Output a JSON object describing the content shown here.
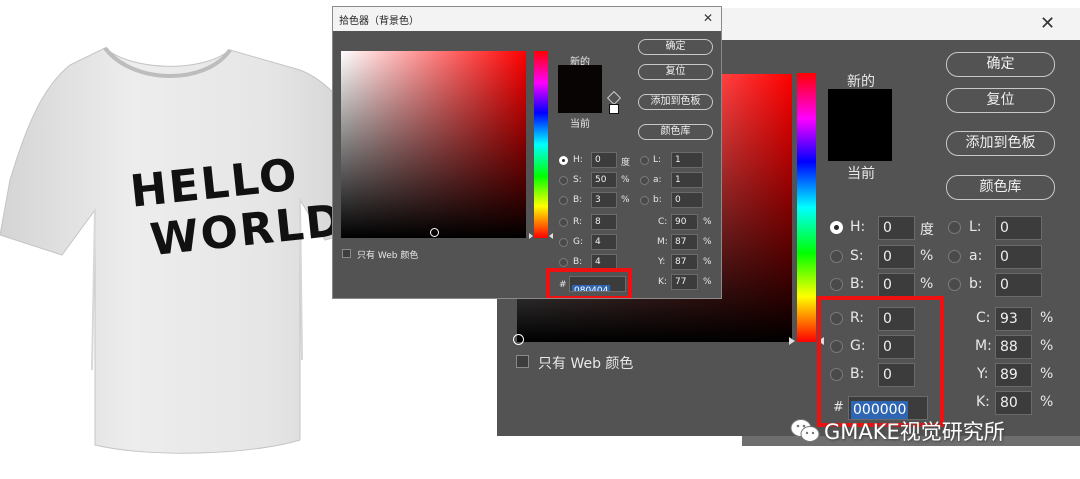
{
  "tshirt": {
    "print_line1": "HELLO",
    "print_line2": "WORLD"
  },
  "big_picker": {
    "close_glyph": "✕",
    "buttons": {
      "ok": "确定",
      "reset": "复位",
      "add_to_swatches": "添加到色板",
      "color_libraries": "颜色库"
    },
    "new_label": "新的",
    "current_label": "当前",
    "new_color": "#000000",
    "current_color": "#000000",
    "hsb": [
      {
        "label": "H:",
        "value": "0",
        "unit": "度"
      },
      {
        "label": "S:",
        "value": "0",
        "unit": "%"
      },
      {
        "label": "B:",
        "value": "0",
        "unit": "%"
      }
    ],
    "lab": [
      {
        "label": "L:",
        "value": "0"
      },
      {
        "label": "a:",
        "value": "0"
      },
      {
        "label": "b:",
        "value": "0"
      }
    ],
    "rgb": [
      {
        "label": "R:",
        "value": "0"
      },
      {
        "label": "G:",
        "value": "0"
      },
      {
        "label": "B:",
        "value": "0"
      }
    ],
    "cmyk": [
      {
        "label": "C:",
        "value": "93",
        "unit": "%"
      },
      {
        "label": "M:",
        "value": "88",
        "unit": "%"
      },
      {
        "label": "Y:",
        "value": "89",
        "unit": "%"
      },
      {
        "label": "K:",
        "value": "80",
        "unit": "%"
      }
    ],
    "hex_label": "#",
    "hex_value": "000000",
    "web_only_label": "只有 Web 颜色"
  },
  "small_picker": {
    "title": "拾色器（背景色）",
    "close_glyph": "✕",
    "buttons": {
      "ok": "确定",
      "reset": "复位",
      "add_to_swatches": "添加到色板",
      "color_libraries": "颜色库"
    },
    "new_label": "新的",
    "current_label": "当前",
    "new_color": "#080404",
    "current_color": "#080404",
    "hsb": [
      {
        "label": "H:",
        "value": "0",
        "unit": "度"
      },
      {
        "label": "S:",
        "value": "50",
        "unit": "%"
      },
      {
        "label": "B:",
        "value": "3",
        "unit": "%"
      }
    ],
    "lab": [
      {
        "label": "L:",
        "value": "1"
      },
      {
        "label": "a:",
        "value": "1"
      },
      {
        "label": "b:",
        "value": "0"
      }
    ],
    "rgb": [
      {
        "label": "R:",
        "value": "8"
      },
      {
        "label": "G:",
        "value": "4"
      },
      {
        "label": "B:",
        "value": "4"
      }
    ],
    "cmyk": [
      {
        "label": "C:",
        "value": "90",
        "unit": "%"
      },
      {
        "label": "M:",
        "value": "87",
        "unit": "%"
      },
      {
        "label": "Y:",
        "value": "87",
        "unit": "%"
      },
      {
        "label": "K:",
        "value": "77",
        "unit": "%"
      }
    ],
    "hex_label": "#",
    "hex_value": "080404",
    "web_only_label": "只有 Web 颜色"
  },
  "watermark": {
    "text": "GMAKE视觉研究所",
    "icon": "wechat-icon"
  },
  "colors": {
    "dialog_bg": "#535353",
    "highlight_box": "#ef1111",
    "selection": "#2f66b3"
  }
}
